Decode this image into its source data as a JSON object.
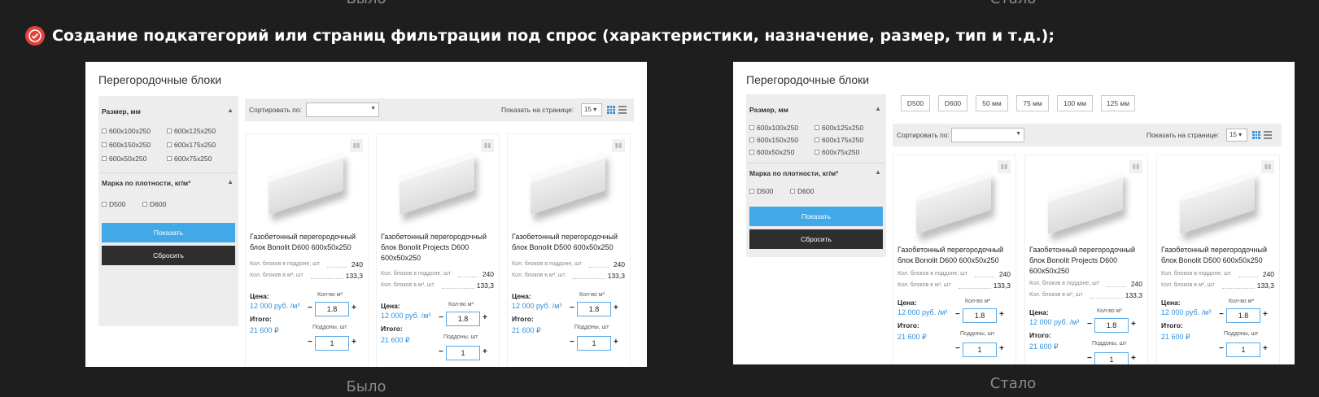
{
  "captions": {
    "before": "Было",
    "after": "Стало"
  },
  "heading": "Создание подкатегорий или страниц фильтрации под спрос (характеристики, назначение, размер, тип и т.д.);",
  "screen": {
    "title": "Перегородочные блоки",
    "filter_size_title": "Размер, мм",
    "sizes": [
      "600x100x250",
      "600x125x250",
      "600x150x250",
      "600x175x250",
      "600x50x250",
      "600x75x250"
    ],
    "filter_density_title": "Марка по плотности, кг/м³",
    "densities": [
      "D500",
      "D600"
    ],
    "show_button": "Показать",
    "reset_button": "Сбросить",
    "sort_label": "Сортировать по:",
    "per_page_label": "Показать на странице:",
    "per_page_value": "15",
    "compare_icon": "bar-chart-icon",
    "quick_tags": [
      "D500",
      "D600",
      "50 мм",
      "75 мм",
      "100 мм",
      "125 мм"
    ],
    "products": [
      {
        "name": "Газобетонный перегородочный блок Bonolit D600 600x50x250"
      },
      {
        "name": "Газобетонный перегородочный блок Bonolit Projects D600 600x50x250"
      },
      {
        "name": "Газобетонный перегородочный блок Bonolit D500 600x50x250"
      }
    ],
    "spec_pallet_label": "Кол. блоков в поддоне, шт",
    "spec_pallet_value": "240",
    "spec_m3_label": "Кол. блоков в м³, шт",
    "spec_m3_value": "133,3",
    "price_label": "Цена:",
    "price_value": "12 000 руб. /м³",
    "qty_m3_label": "Кол-во м³",
    "qty_m3_value": "1.8",
    "total_label": "Итого:",
    "total_value": "21 600 ₽",
    "pallets_label": "Поддоны, шт",
    "pallets_value": "1",
    "minus": "−",
    "plus": "+"
  },
  "colors": {
    "background": "#1e1e1e",
    "accent_red": "#e2413c",
    "primary_blue": "#42a9e8",
    "dark_button": "#2e2e2e"
  }
}
